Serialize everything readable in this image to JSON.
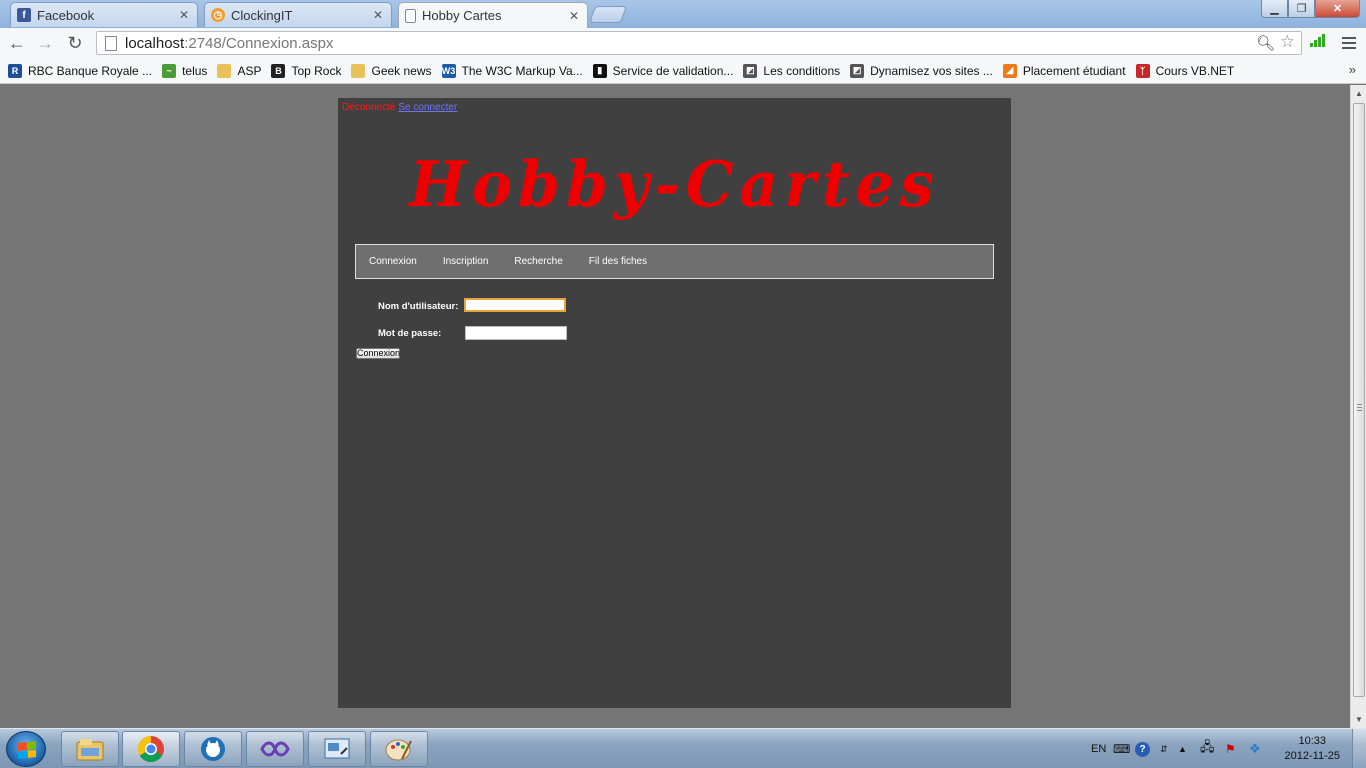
{
  "browser": {
    "tabs": [
      {
        "title": "Facebook",
        "icon": "facebook-icon",
        "color": "#3b5998",
        "glyph": "f",
        "active": false
      },
      {
        "title": "ClockingIT",
        "icon": "clock-icon",
        "color": "#f0a030",
        "glyph": "◷",
        "active": false
      },
      {
        "title": "Hobby Cartes",
        "icon": "page-icon",
        "color": "#ffffff",
        "glyph": "",
        "active": true
      }
    ],
    "address": {
      "host": "localhost",
      "rest": ":2748/Connexion.aspx"
    },
    "bookmarks": [
      {
        "label": "RBC Banque Royale ...",
        "icon": "rbc-icon",
        "color": "#1c4e9c",
        "glyph": "R"
      },
      {
        "label": "telus",
        "icon": "telus-icon",
        "color": "#4b9b3a",
        "glyph": "~"
      },
      {
        "label": "ASP",
        "icon": "folder-icon",
        "color": "#e8c15a",
        "glyph": ""
      },
      {
        "label": "Top Rock",
        "icon": "b-icon",
        "color": "#222222",
        "glyph": "B"
      },
      {
        "label": "Geek news",
        "icon": "folder-icon",
        "color": "#e8c15a",
        "glyph": ""
      },
      {
        "label": "The W3C Markup Va...",
        "icon": "w3c-icon",
        "color": "#1e5aa8",
        "glyph": "W3"
      },
      {
        "label": "Service de validation...",
        "icon": "validator-icon",
        "color": "#111111",
        "glyph": "▮"
      },
      {
        "label": "Les conditions",
        "icon": "page-fold-icon",
        "color": "#555555",
        "glyph": "◩"
      },
      {
        "label": "Dynamisez vos sites ...",
        "icon": "page-fold-icon",
        "color": "#555555",
        "glyph": "◩"
      },
      {
        "label": "Placement étudiant",
        "icon": "placement-icon",
        "color": "#f07a1a",
        "glyph": "◢"
      },
      {
        "label": "Cours VB.NET",
        "icon": "vb-icon",
        "color": "#c62828",
        "glyph": "ᛉ"
      }
    ]
  },
  "page": {
    "login_status": "Déconnecté",
    "login_link": "Se connecter",
    "logo": "Hobby-Cartes",
    "menu": [
      "Connexion",
      "Inscription",
      "Recherche",
      "Fil des fiches"
    ],
    "form": {
      "username_label": "Nom d'utilisateur:",
      "username_value": "",
      "password_label": "Mot de passe:",
      "password_value": "",
      "submit_label": "Connexion"
    },
    "colors": {
      "page_bg": "#404040",
      "outer_bg": "#757575",
      "logo": "#ee0000",
      "status": "#ff1a1a",
      "link": "#6f74ff"
    }
  },
  "taskbar": {
    "apps": [
      {
        "icon": "explorer-icon",
        "active": false
      },
      {
        "icon": "chrome-icon",
        "active": true
      },
      {
        "icon": "cat-icon",
        "active": false
      },
      {
        "icon": "visual-studio-icon",
        "active": false
      },
      {
        "icon": "control-panel-icon",
        "active": false
      },
      {
        "icon": "paint-icon",
        "active": false
      }
    ],
    "language": "EN",
    "time": "10:33",
    "date": "2012-11-25"
  }
}
